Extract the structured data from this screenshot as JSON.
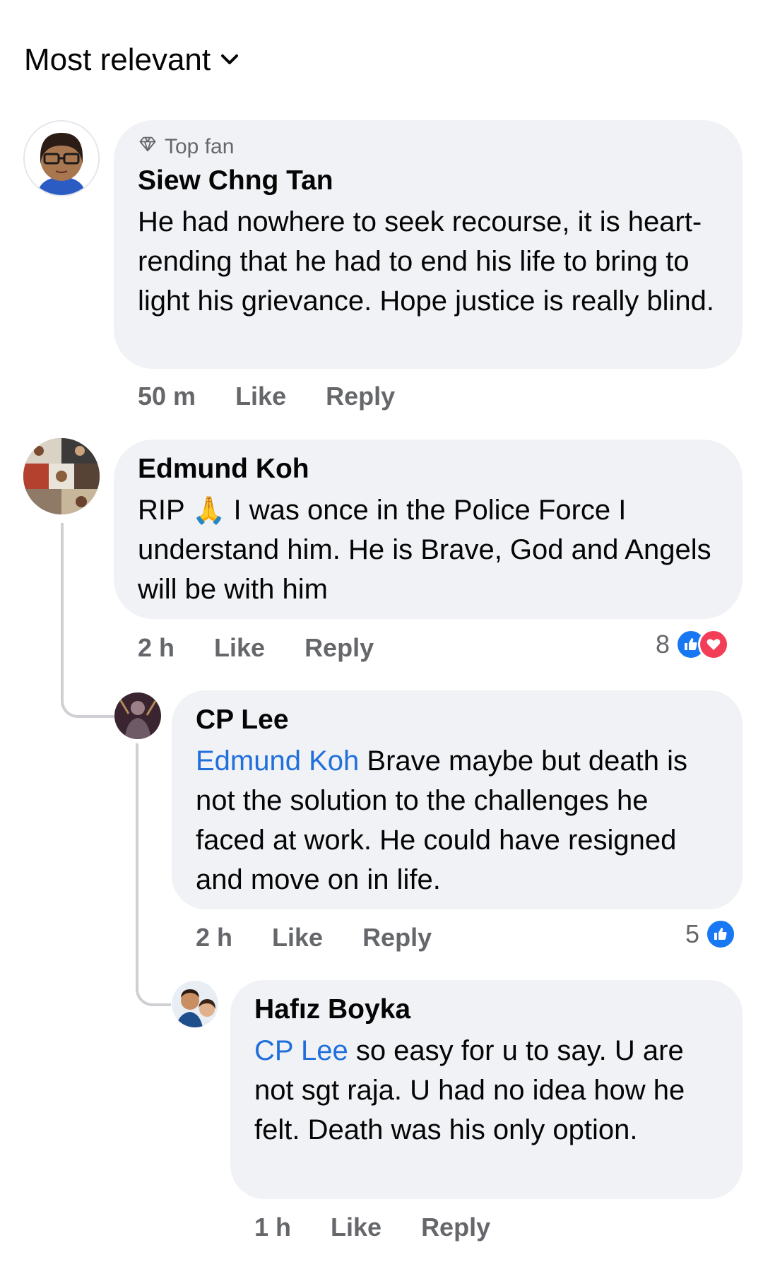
{
  "sort": {
    "label": "Most relevant"
  },
  "comments": [
    {
      "badge": "Top fan",
      "author": "Siew Chng Tan",
      "text": "He had nowhere to seek recourse, it is heart-rending that he had to end his life to bring to light his grievance.  Hope justice is really blind.",
      "time": "50 m",
      "like": "Like",
      "reply": "Reply"
    },
    {
      "author": "Edmund Koh",
      "text_before": "RIP",
      "emoji": "🙏",
      "text_after": " I was once in the Police Force I understand him. He is Brave, God and Angels will be with him",
      "time": "2 h",
      "like": "Like",
      "reply": "Reply",
      "reaction_count": "8"
    },
    {
      "author": "CP Lee",
      "mention": "Edmund Koh",
      "text": " Brave maybe but death is not the solution to the challenges he faced at work. He could have resigned and move on in life.",
      "time": "2 h",
      "like": "Like",
      "reply": "Reply",
      "reaction_count": "5"
    },
    {
      "author": "Hafız Boyka",
      "mention": "CP Lee",
      "text": " so easy for u to say. U are not sgt raja. U had no idea how he felt. Death was his only option.",
      "time": "1 h",
      "like": "Like",
      "reply": "Reply"
    }
  ],
  "colors": {
    "bubble": "#f0f2f5",
    "mention": "#216fdb",
    "meta": "#65676b",
    "like_blue": "#1877f2",
    "love_red": "#f33e58"
  },
  "icons": [
    "chevron-down-icon",
    "diamond-icon",
    "like-reaction-icon",
    "love-reaction-icon",
    "pray-emoji"
  ]
}
